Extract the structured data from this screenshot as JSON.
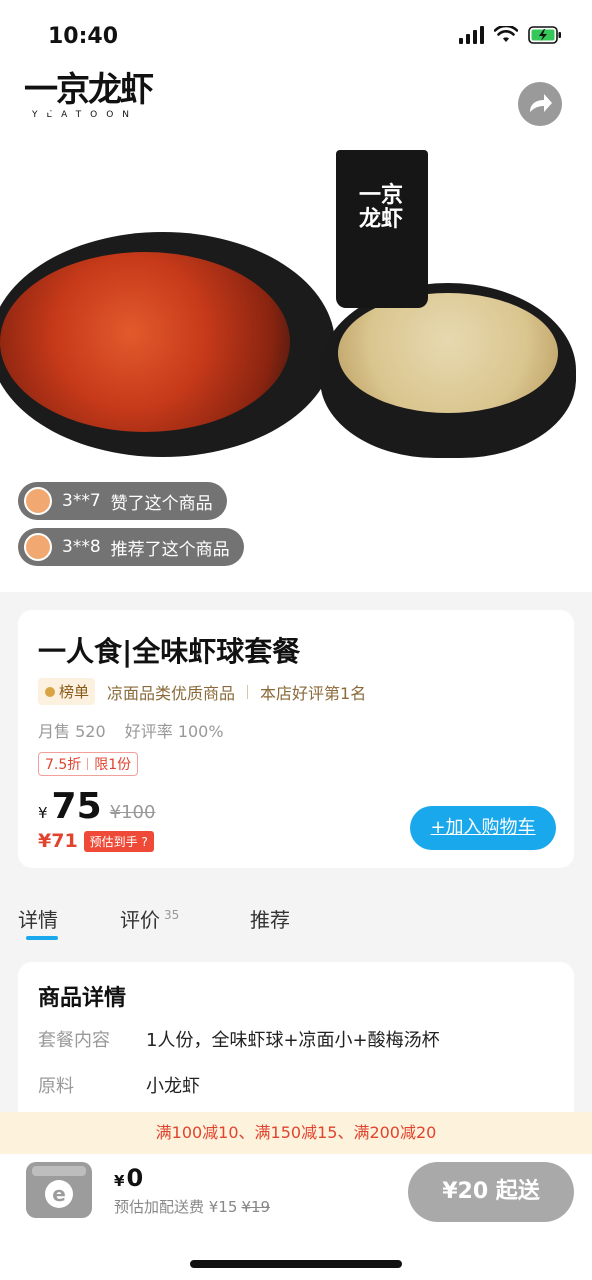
{
  "status_bar": {
    "time": "10:40"
  },
  "brand": {
    "logo_text": "一京龙虾",
    "logo_sub": "YEATOON",
    "cup_label": "一京龙虾"
  },
  "social_proof": [
    {
      "user": "3**7",
      "text": "赞了这个商品"
    },
    {
      "user": "3**8",
      "text": "推荐了这个商品"
    }
  ],
  "product": {
    "title": "一人食|全味虾球套餐",
    "rank_badge": "榜单",
    "rank_category": "凉面品类优质商品",
    "rank_store": "本店好评第1名",
    "monthly_sales": "月售 520",
    "rating": "好评率 100%",
    "discount": "7.5折",
    "limit": "限1份",
    "currency": "¥",
    "price_now": "75",
    "price_orig": "¥100",
    "est_price": "¥71",
    "est_label": "预估到手 ?",
    "add_to_cart": "+加入购物车"
  },
  "tabs": [
    {
      "label": "详情",
      "active": true
    },
    {
      "label": "评价",
      "count": "35"
    },
    {
      "label": "推荐"
    }
  ],
  "details": {
    "title": "商品详情",
    "rows": [
      {
        "label": "套餐内容",
        "value": "1人份，全味虾球+凉面小+酸梅汤杯"
      },
      {
        "label": "原料",
        "value": "小龙虾"
      }
    ]
  },
  "promo": "满100减10、满150减15、满200减20",
  "cart": {
    "currency": "¥",
    "total": "0",
    "delivery_label": "预估加配送费",
    "delivery_fee": "¥15",
    "delivery_fee_orig": "¥19",
    "min_order": "¥20 起送"
  },
  "colors": {
    "accent": "#19a8ec",
    "price_red": "#e0442f"
  }
}
